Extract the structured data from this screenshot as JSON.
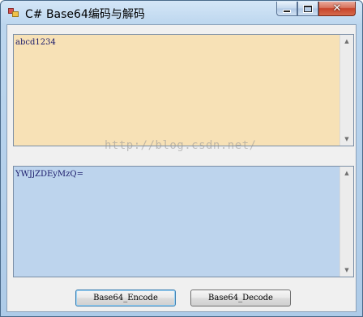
{
  "window": {
    "title": "C# Base64编码与解码",
    "controls": {
      "minimize": "minimize",
      "maximize": "maximize",
      "close": "✕"
    }
  },
  "input_box": {
    "value": "abcd1234"
  },
  "output_box": {
    "value": "YWJjZDEyMzQ="
  },
  "watermark": {
    "text": "http://blog.csdn.net/"
  },
  "buttons": {
    "encode_label": "Base64_Encode",
    "decode_label": "Base64_Decode"
  },
  "colors": {
    "input_bg": "#f7e1b6",
    "output_bg": "#bdd4ed",
    "titlebar": "#bcd6ee",
    "close_button": "#c8442a"
  },
  "icons": {
    "app": "app-icon",
    "minimize": "minimize-icon",
    "maximize": "maximize-icon",
    "close": "close-icon",
    "scroll_up": "scroll-up-arrow-icon",
    "scroll_down": "scroll-down-arrow-icon"
  }
}
